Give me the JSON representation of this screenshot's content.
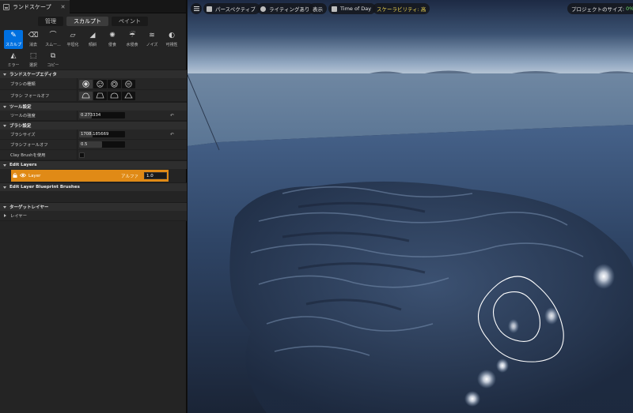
{
  "panel": {
    "tab_title": "ランドスケープ",
    "close_glyph": "✕",
    "modes": [
      "管理",
      "スカルプト",
      "ペイント"
    ],
    "active_mode": "スカルプト",
    "tools": [
      {
        "label": "スカルプ",
        "icon": "sculpt-brush-icon",
        "glyph": "✎"
      },
      {
        "label": "消去",
        "icon": "erase-icon",
        "glyph": "⌫"
      },
      {
        "label": "スムー...",
        "icon": "smooth-icon",
        "glyph": "⌒"
      },
      {
        "label": "平坦化",
        "icon": "flatten-icon",
        "glyph": "⏥"
      },
      {
        "label": "傾斜",
        "icon": "ramp-icon",
        "glyph": "◢"
      },
      {
        "label": "侵食",
        "icon": "erosion-icon",
        "glyph": "✺"
      },
      {
        "label": "水侵食",
        "icon": "hydro-erosion-icon",
        "glyph": "☔"
      },
      {
        "label": "ノイズ",
        "icon": "noise-icon",
        "glyph": "≋"
      },
      {
        "label": "可視性",
        "icon": "visibility-icon",
        "glyph": "◐"
      },
      {
        "label": "ミラー",
        "icon": "mirror-icon",
        "glyph": "◭"
      },
      {
        "label": "選択",
        "icon": "select-icon",
        "glyph": "⬚"
      },
      {
        "label": "コピー",
        "icon": "copy-icon",
        "glyph": "⧉"
      }
    ],
    "sections": {
      "editor": "ランドスケープエディタ",
      "tool_settings": "ツール設定",
      "brush_settings": "ブラシ設定",
      "edit_layers": "Edit Layers",
      "blueprint_brushes": "Edit Layer Blueprint Brushes",
      "target_layers": "ターゲットレイヤー",
      "layers_sub": "レイヤー"
    },
    "labels": {
      "brush_type": "ブラシの種類",
      "brush_falloff_type": "ブラシ フォールオフ",
      "tool_strength": "ツールの強度",
      "brush_size": "ブラシサイズ",
      "brush_falloff": "ブラシフォールオフ",
      "use_clay_brush": "Clay Brushを使用"
    },
    "values": {
      "tool_strength": "0.273334",
      "tool_strength_fraction": 0.27,
      "brush_size": "1708.185669",
      "brush_size_fraction": 0.3,
      "brush_falloff": "0.5",
      "brush_falloff_fraction": 0.5
    },
    "reset_glyph": "↶",
    "layer": {
      "name": "Layer",
      "alpha_label": "アルファ",
      "alpha_value": "1.0"
    }
  },
  "viewport": {
    "toolbar": {
      "perspective": "パースペクティブ",
      "lighting": "ライティングあり",
      "show": "表示",
      "time_of_day": "Time of Day",
      "scalability": "スケーラビリティ: 高",
      "project_size_label": "プロジェクトのサイズ:",
      "project_size_value": "0%"
    }
  },
  "colors": {
    "accent_blue": "#0070e0",
    "layer_orange": "#e08a16",
    "scalability_yellow": "#f0d650"
  }
}
